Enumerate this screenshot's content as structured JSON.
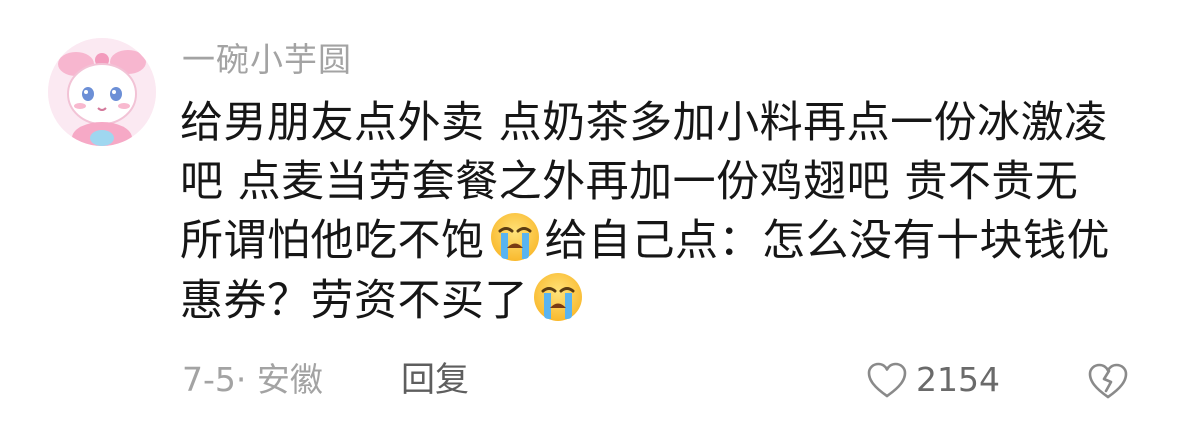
{
  "comment": {
    "username": "一碗小芋圆",
    "avatar_icon": "pink-cartoon-avatar",
    "text_segments": [
      "给男朋友点外卖 点奶茶多加小料再点一份冰激凌吧 点麦当劳套餐之外再加一份鸡翅吧 贵不贵无所谓怕他吃不饱",
      "给自己点：怎么没有十块钱优惠券？劳资不买了"
    ],
    "emoji_icon": "loudly-crying-face-emoji",
    "meta": "7-5· 安徽",
    "reply_label": "回复",
    "like_count": "2154",
    "like_icon": "heart-outline-icon",
    "dislike_icon": "broken-heart-outline-icon"
  },
  "colors": {
    "username": "#a3a3a3",
    "body_text": "#161616",
    "meta": "#a3a3a3",
    "reply": "#5e5e5e",
    "icon_stroke": "#8a8a8a"
  }
}
